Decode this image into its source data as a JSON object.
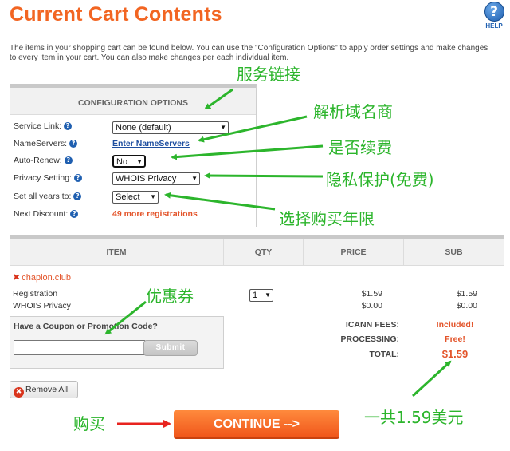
{
  "page": {
    "title": "Current Cart Contents",
    "help_label": "HELP",
    "help_icon": "?",
    "intro": "The items in your shopping cart can be found below. You can use the \"Configuration Options\" to apply order settings and make changes to every item in your cart. You can also make changes per each individual item."
  },
  "config": {
    "header": "CONFIGURATION OPTIONS",
    "rows": [
      {
        "label": "Service Link:",
        "value": "None (default)"
      },
      {
        "label": "NameServers:",
        "value": "Enter NameServers"
      },
      {
        "label": "Auto-Renew:",
        "value": "No"
      },
      {
        "label": "Privacy Setting:",
        "value": "WHOIS Privacy"
      },
      {
        "label": "Set all years to:",
        "value": "Select"
      },
      {
        "label": "Next Discount:",
        "value": "49 more registrations"
      }
    ]
  },
  "cart": {
    "columns": [
      "ITEM",
      "QTY",
      "PRICE",
      "SUB"
    ],
    "item_name": "chapion.club",
    "remove_glyph": "✖",
    "qty": "1",
    "lines": [
      {
        "label": "Registration",
        "price": "$1.59",
        "sub": "$1.59"
      },
      {
        "label": "WHOIS Privacy",
        "price": "$0.00",
        "sub": "$0.00"
      }
    ],
    "fees": [
      {
        "label": "ICANN FEES:",
        "value": "Included!"
      },
      {
        "label": "PROCESSING:",
        "value": "Free!"
      },
      {
        "label": "TOTAL:",
        "value": "$1.59"
      }
    ]
  },
  "coupon": {
    "title": "Have a Coupon or Promotion Code?",
    "input_value": "",
    "submit_label": "Submit"
  },
  "actions": {
    "remove_all": "Remove All",
    "continue": "CONTINUE -->"
  },
  "annotations": {
    "service_link": "服务链接",
    "nameservers": "解析域名商",
    "auto_renew": "是否续费",
    "privacy": "隐私保护(免费)",
    "years": "选择购买年限",
    "coupon": "优惠券",
    "total": "一共1.59美元",
    "buy": "购买"
  },
  "colors": {
    "title_orange": "#f26522",
    "annotation_green": "#2cb52c",
    "annotation_red": "#e8231f",
    "continue_orange": "#f0561a",
    "link_blue": "#1f4fa0"
  }
}
